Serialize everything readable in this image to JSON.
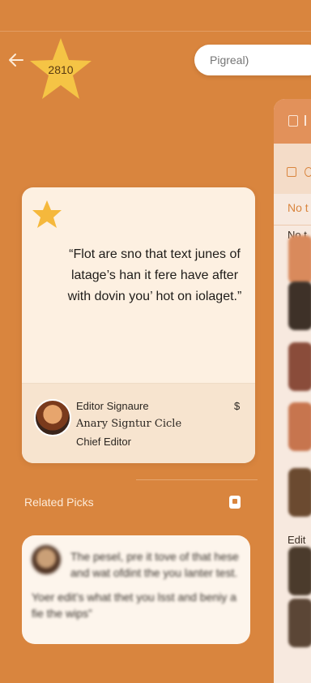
{
  "header": {
    "star_value": "2810",
    "search_placeholder": "Pigreal)"
  },
  "card": {
    "quote": "“Flot are sno that text junes of latage’s han it fere have after with dovin you’ hot on iolaget.”",
    "footer": {
      "signature_title": "Editor Signaure",
      "signature_script": "Anary Signtur Cicle",
      "role": "Chief Editor",
      "amount": "$"
    }
  },
  "related": {
    "title": "Related Picks",
    "item": {
      "text1": "The pesel, pre it tove of that hese and wat ofdint the you lanter test.",
      "text2": "Yoer edit’s what thet you lsst and beniy a fie the wips”"
    }
  },
  "side_panel": {
    "tab": "No t",
    "label_top": "No t",
    "label_bottom": "Edit"
  },
  "colors": {
    "background": "#d9853e",
    "card": "#fdf0e1",
    "star": "#f5c445"
  },
  "icons": {
    "back": "arrow-left-icon",
    "badge": "star-icon"
  }
}
